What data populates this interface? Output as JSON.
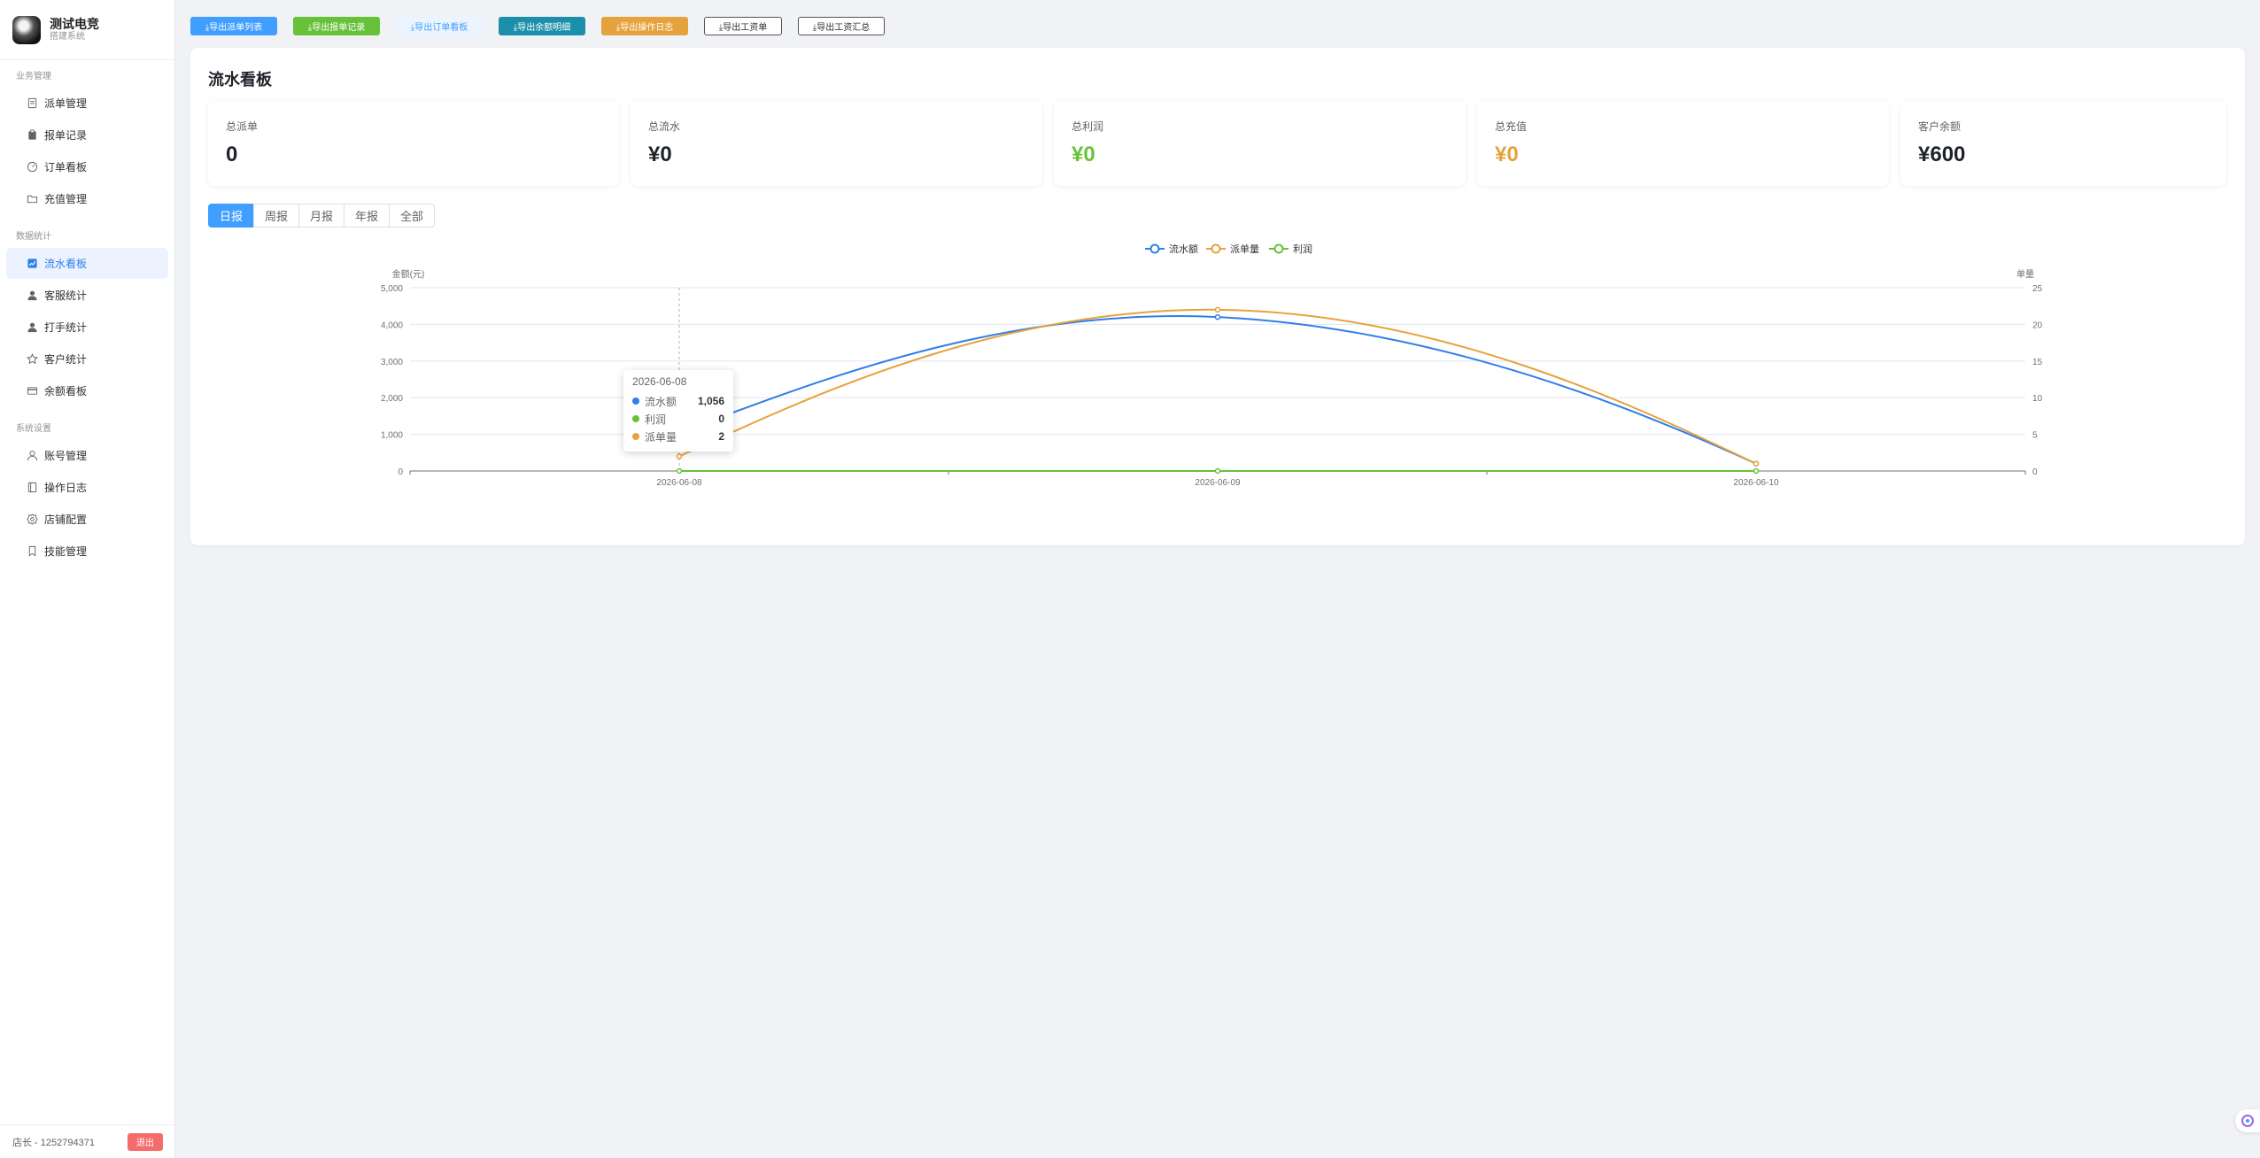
{
  "brand": {
    "name": "测试电竞",
    "subtitle": "搭建系统"
  },
  "sidebar": {
    "groups": [
      {
        "title": "业务管理",
        "items": [
          {
            "label": "派单管理",
            "icon": "document-icon"
          },
          {
            "label": "报单记录",
            "icon": "clipboard-icon"
          },
          {
            "label": "订单看板",
            "icon": "gauge-icon"
          },
          {
            "label": "充值管理",
            "icon": "folder-icon"
          }
        ]
      },
      {
        "title": "数据统计",
        "items": [
          {
            "label": "流水看板",
            "icon": "chart-icon",
            "active": true
          },
          {
            "label": "客服统计",
            "icon": "user-icon"
          },
          {
            "label": "打手统计",
            "icon": "user-icon"
          },
          {
            "label": "客户统计",
            "icon": "star-icon"
          },
          {
            "label": "余额看板",
            "icon": "card-icon"
          }
        ]
      },
      {
        "title": "系统设置",
        "items": [
          {
            "label": "账号管理",
            "icon": "user-outline-icon"
          },
          {
            "label": "操作日志",
            "icon": "book-icon"
          },
          {
            "label": "店铺配置",
            "icon": "gear-icon"
          },
          {
            "label": "技能管理",
            "icon": "bookmark-icon"
          }
        ]
      }
    ],
    "footer": {
      "user": "店长 - 1252794371",
      "logout": "退出"
    }
  },
  "toolbar": [
    {
      "label": "⤓导出派单列表",
      "style": "blue"
    },
    {
      "label": "⤓导出报单记录",
      "style": "green"
    },
    {
      "label": "⤓导出订单看板",
      "style": "plain-blue"
    },
    {
      "label": "⤓导出余额明细",
      "style": "teal"
    },
    {
      "label": "⤓导出操作日志",
      "style": "orange"
    },
    {
      "label": "⤓导出工资单",
      "style": "outline"
    },
    {
      "label": "⤓导出工资汇总",
      "style": "outline2"
    }
  ],
  "page": {
    "title": "流水看板"
  },
  "stats": [
    {
      "label": "总派单",
      "value": "0",
      "color": "default"
    },
    {
      "label": "总流水",
      "value": "¥0",
      "color": "default"
    },
    {
      "label": "总利润",
      "value": "¥0",
      "color": "green"
    },
    {
      "label": "总充值",
      "value": "¥0",
      "color": "orange"
    },
    {
      "label": "客户余额",
      "value": "¥600",
      "color": "default"
    }
  ],
  "periods": [
    {
      "label": "日报",
      "active": true
    },
    {
      "label": "周报"
    },
    {
      "label": "月报"
    },
    {
      "label": "年报"
    },
    {
      "label": "全部"
    }
  ],
  "chart_data": {
    "type": "line",
    "categories": [
      "2026-06-08",
      "2026-06-09",
      "2026-06-10"
    ],
    "series": [
      {
        "name": "流水额",
        "axis": "left",
        "color": "#2f7fe8",
        "values": [
          1056,
          4200,
          200
        ]
      },
      {
        "name": "派单量",
        "axis": "right",
        "color": "#e6a23c",
        "values": [
          2,
          22,
          1
        ]
      },
      {
        "name": "利润",
        "axis": "left",
        "color": "#67c23a",
        "values": [
          0,
          0,
          0
        ]
      }
    ],
    "ylabel_left": "金额(元)",
    "ylabel_right": "单量",
    "ylim_left": [
      0,
      5000
    ],
    "ylim_right": [
      0,
      25
    ],
    "yticks_left": [
      "0",
      "1,000",
      "2,000",
      "3,000",
      "4,000",
      "5,000"
    ],
    "yticks_right": [
      "0",
      "5",
      "10",
      "15",
      "20",
      "25"
    ],
    "legend": "top-center",
    "smooth": true,
    "grid": true,
    "tooltip": {
      "date": "2026-06-08",
      "rows": [
        {
          "name": "流水额",
          "value": "1,056",
          "color": "#2f7fe8"
        },
        {
          "name": "利润",
          "value": "0",
          "color": "#67c23a"
        },
        {
          "name": "派单量",
          "value": "2",
          "color": "#e6a23c"
        }
      ]
    }
  }
}
